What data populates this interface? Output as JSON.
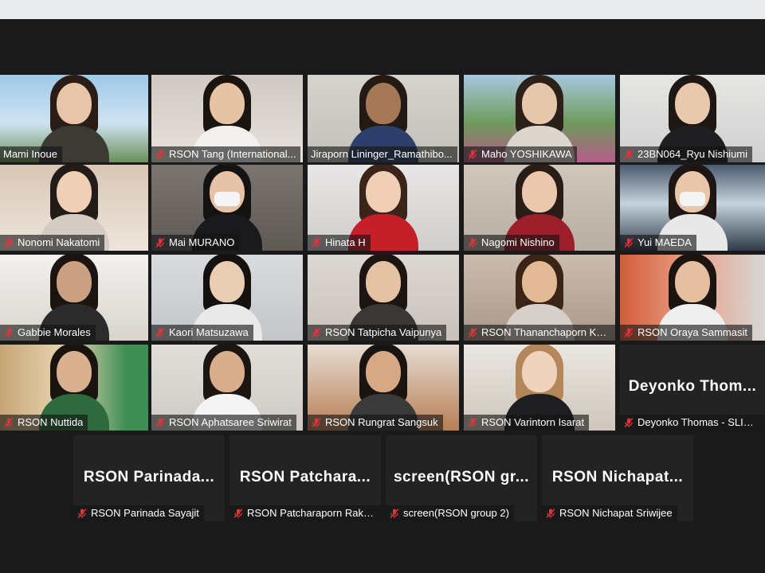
{
  "gallery": {
    "video_tiles": [
      {
        "name": "Mami Inoue",
        "muted": false,
        "active": true
      },
      {
        "name": "RSON Tang (International...",
        "muted": true
      },
      {
        "name": "Jiraporn Lininger_Ramathibo...",
        "muted": false
      },
      {
        "name": "Maho YOSHIKAWA",
        "muted": true
      },
      {
        "name": "23BN064_Ryu Nishiumi",
        "muted": true
      },
      {
        "name": "Nonomi Nakatomi",
        "muted": true
      },
      {
        "name": "Mai MURANO",
        "muted": true
      },
      {
        "name": "Hinata H",
        "muted": true
      },
      {
        "name": "Nagomi Nishino",
        "muted": true
      },
      {
        "name": "Yui MAEDA",
        "muted": true
      },
      {
        "name": "Gabbie Morales",
        "muted": true
      },
      {
        "name": "Kaori Matsuzawa",
        "muted": true
      },
      {
        "name": "RSON Tatpicha Vaipunya",
        "muted": true
      },
      {
        "name": "RSON Thananchaporn Ke...",
        "muted": true
      },
      {
        "name": "RSON Oraya Sammasit",
        "muted": true
      },
      {
        "name": "RSON Nuttida",
        "muted": true
      },
      {
        "name": "RSON Aphatsaree Sriwirat",
        "muted": true
      },
      {
        "name": "RSON Rungrat Sangsuk",
        "muted": true
      },
      {
        "name": "RSON Varintorn Isarat",
        "muted": true
      }
    ],
    "audio_tiles": [
      {
        "display": "Deyonko Thom...",
        "name": "Deyonko Thomas - SLIU I...",
        "muted": true
      },
      {
        "display": "RSON Parinada...",
        "name": "RSON Parinada Sayajit",
        "muted": true
      },
      {
        "display": "RSON Patchara...",
        "name": "RSON Patcharaporn Rakp...",
        "muted": true
      },
      {
        "display": "screen(RSON gr...",
        "name": "screen(RSON group 2)",
        "muted": true
      },
      {
        "display": "RSON Nichapat...",
        "name": "RSON Nichapat Sriwijee",
        "muted": true
      }
    ]
  },
  "icons": {
    "muted": "mic-muted-icon"
  },
  "colors": {
    "active_border": "#c9d957",
    "muted_icon": "#e0343c",
    "background": "#1a1a1a"
  }
}
